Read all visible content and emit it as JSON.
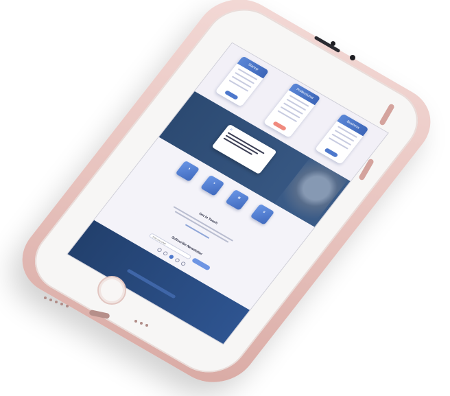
{
  "scene": {
    "phone_color": "#e7c2bd",
    "screen_background": "#f3f1f7",
    "accent": "#4d78cc",
    "dark_band": "#2c4a72"
  },
  "screen": {
    "pricing": {
      "cards": [
        {
          "title": "Startup"
        },
        {
          "title": "Professional"
        },
        {
          "title": "Business"
        }
      ]
    },
    "testimonial": {
      "quote_mark": "“"
    },
    "stats": {
      "items": [
        {
          "icon": "download-icon"
        },
        {
          "icon": "heart-icon"
        },
        {
          "icon": "chart-icon"
        },
        {
          "icon": "trophy-icon"
        }
      ]
    },
    "contact": {
      "title": "Get In Touch"
    },
    "newsletter": {
      "title": "Subscribe Newsletter",
      "input_placeholder": "Enter your email"
    },
    "footer": {
      "line": ""
    }
  }
}
